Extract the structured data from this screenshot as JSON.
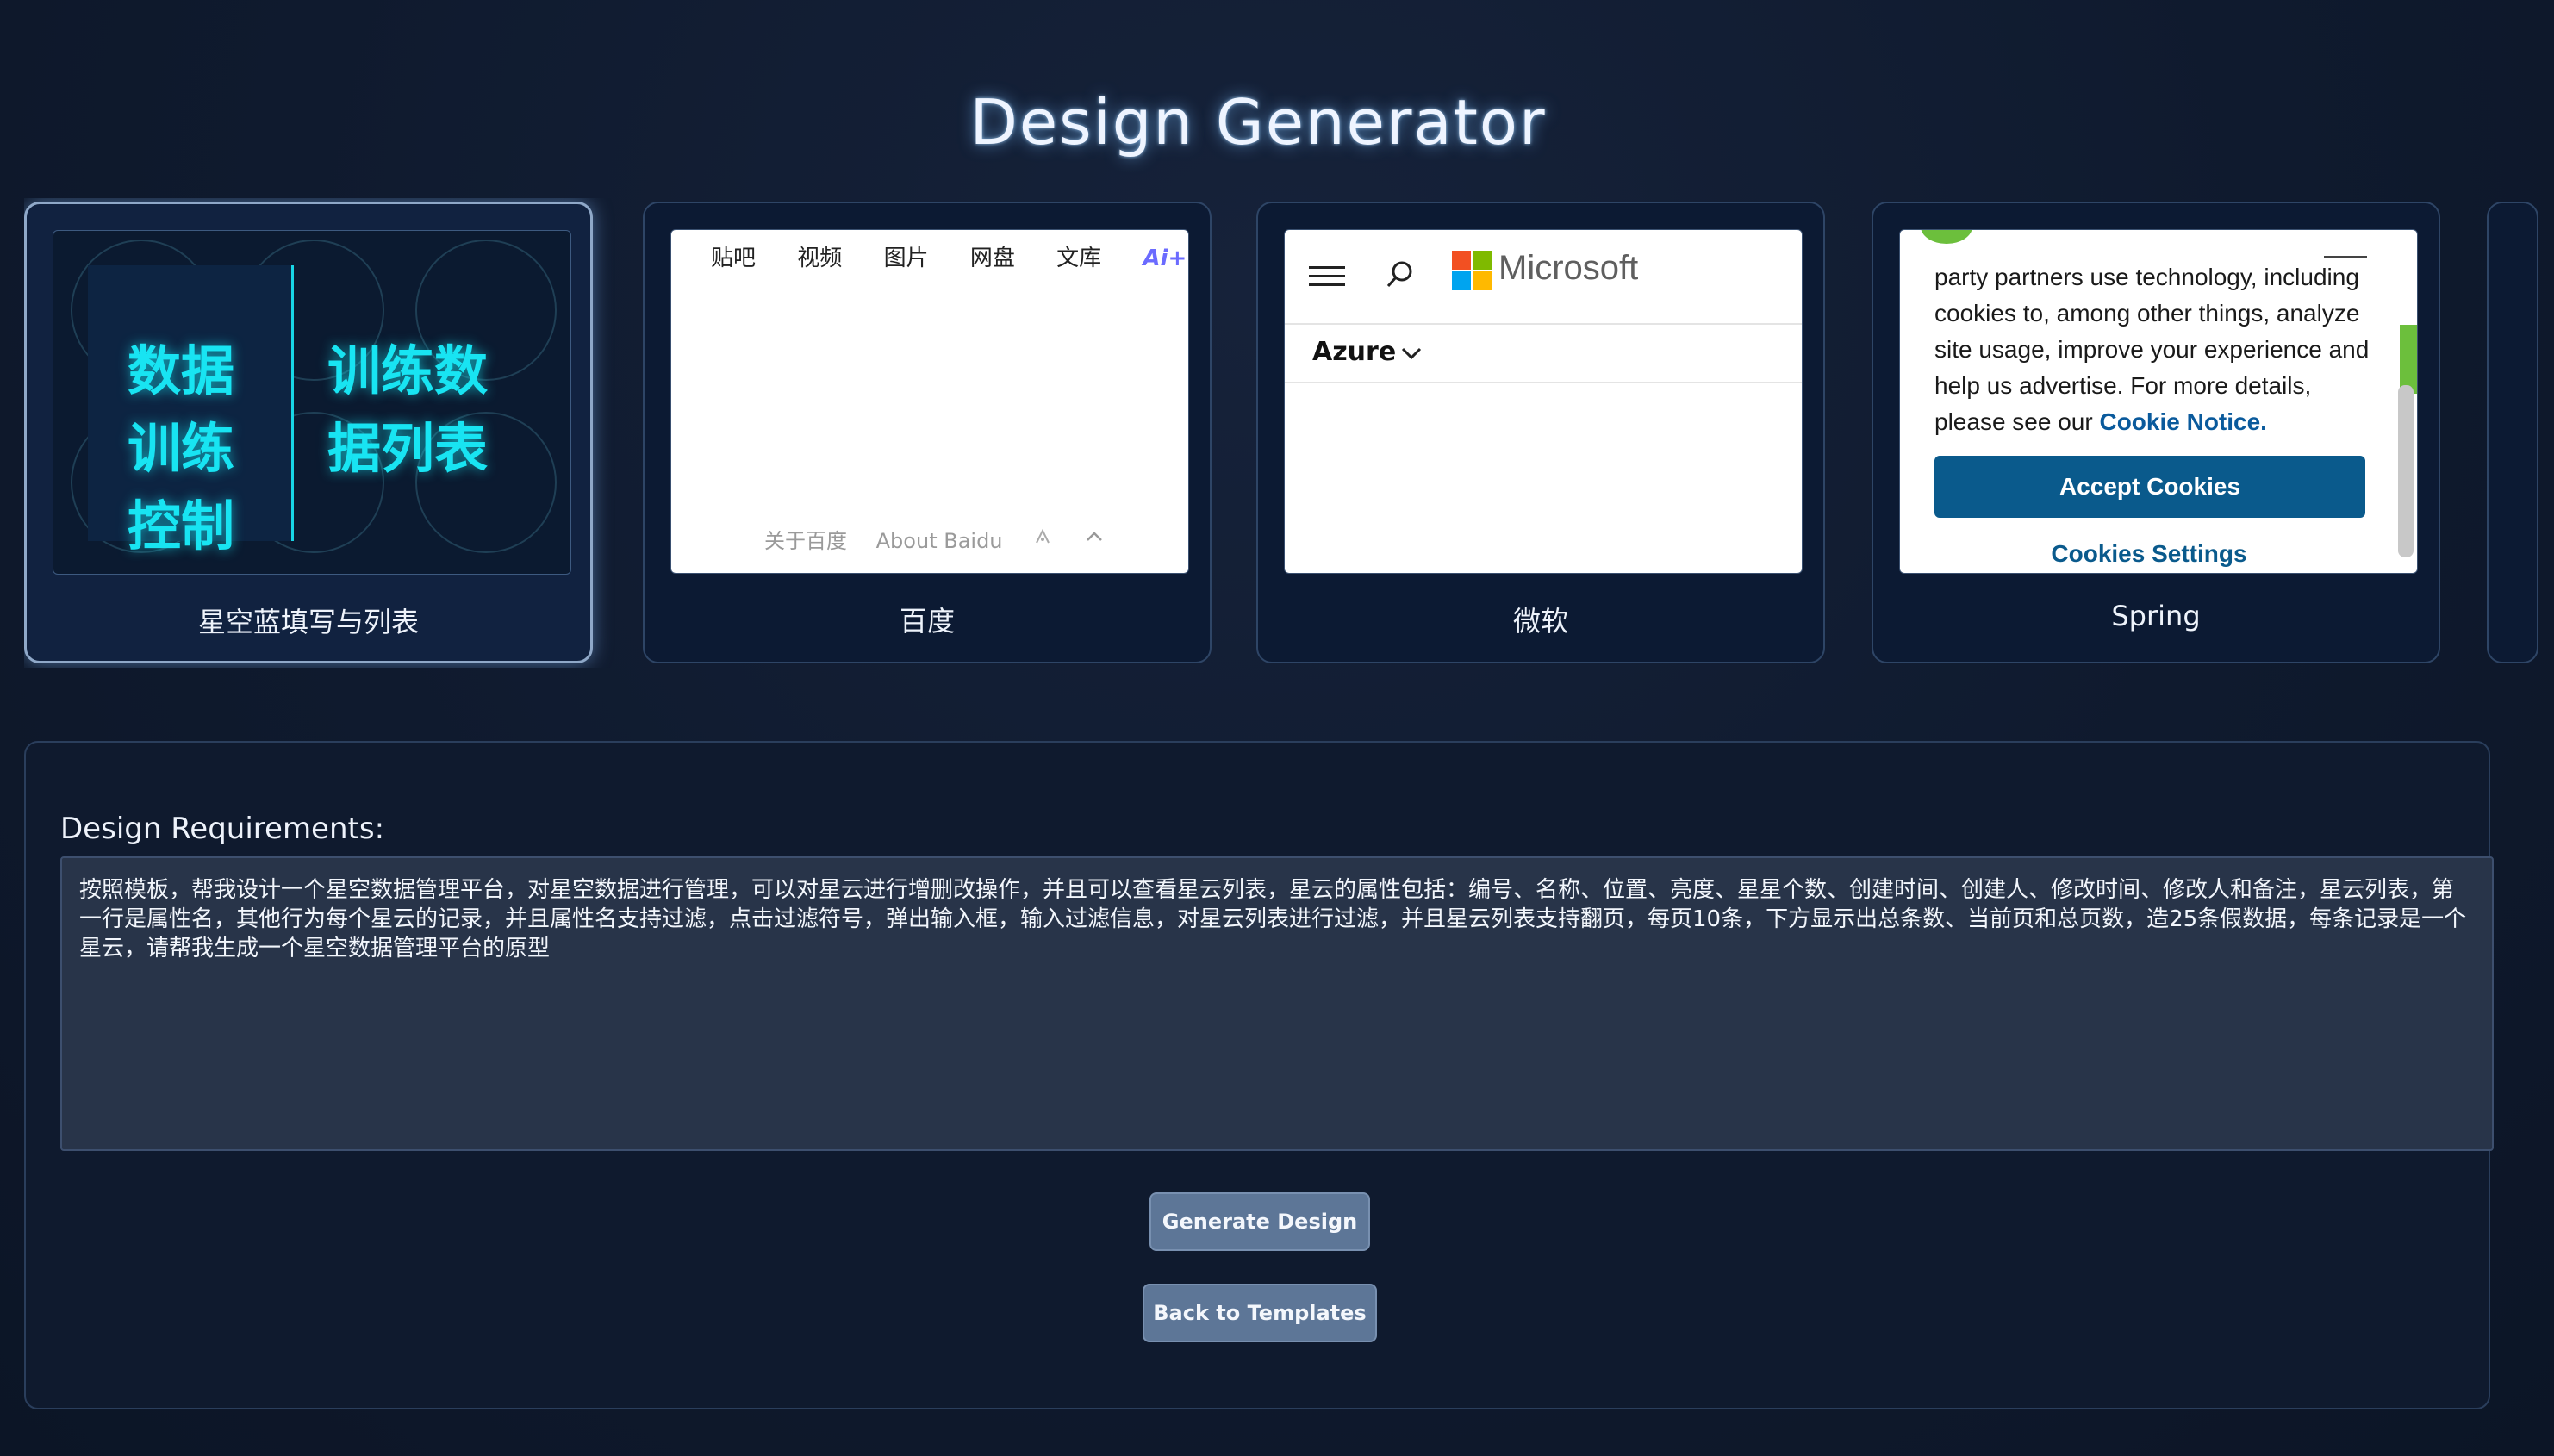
{
  "page": {
    "title": "Design Generator"
  },
  "templates": [
    {
      "label": "星空蓝填写与列表",
      "selected": true,
      "preview": {
        "left_text": [
          "数据",
          "训练",
          "控制"
        ],
        "right_text": [
          "训练数",
          "据列表"
        ]
      }
    },
    {
      "label": "百度",
      "selected": false,
      "preview": {
        "nav": [
          "贴吧",
          "视频",
          "图片",
          "网盘",
          "文库"
        ],
        "ai_badge": "Ai+",
        "footer": [
          "关于百度",
          "About Baidu"
        ]
      }
    },
    {
      "label": "微软",
      "selected": false,
      "preview": {
        "brand": "Microsoft",
        "menu": "Azure"
      }
    },
    {
      "label": "Spring",
      "selected": false,
      "preview": {
        "cookie_text": "party partners use technology, including cookies to, among other things, analyze site usage, improve your experience and help us advertise. For more details, please see our",
        "cookie_link": "Cookie Notice.",
        "accept_button": "Accept Cookies",
        "settings_link": "Cookies Settings"
      }
    }
  ],
  "form": {
    "label": "Design Requirements:",
    "requirements": "按照模板，帮我设计一个星空数据管理平台，对星空数据进行管理，可以对星云进行增删改操作，并且可以查看星云列表，星云的属性包括：编号、名称、位置、亮度、星星个数、创建时间、创建人、修改时间、修改人和备注，星云列表，第一行是属性名，其他行为每个星云的记录，并且属性名支持过滤，点击过滤符号，弹出输入框，输入过滤信息，对星云列表进行过滤，并且星云列表支持翻页，每页10条，下方显示出总条数、当前页和总页数，造25条假数据，每条记录是一个星云，请帮我生成一个星空数据管理平台的原型",
    "generate_button": "Generate Design",
    "back_button": "Back to Templates"
  }
}
